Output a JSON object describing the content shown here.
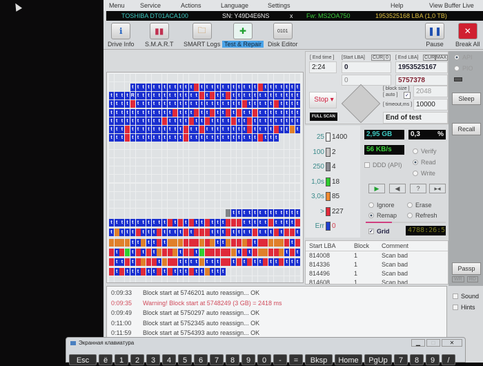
{
  "menu": [
    "Menu",
    "Service",
    "Actions",
    "Language",
    "Settings",
    "Help",
    "View Buffer Live"
  ],
  "drive": {
    "model": "TOSHIBA DT01ACA100",
    "sn": "SN: Y49D4E6NS",
    "x": "x",
    "fw": "Fw: MS2OA750",
    "lba": "1953525168 LBA (1,0 TB)"
  },
  "toolbar": {
    "drive_info": "Drive Info",
    "smart": "S.M.A.R.T",
    "smart_logs": "SMART Logs",
    "test_repair": "Test & Repair",
    "disk_editor": "Disk Editor",
    "pause": "Pause",
    "break_all": "Break All"
  },
  "controls": {
    "end_time_label": "[ End time ]",
    "end_time": "2:24",
    "start_lba_label": "[Start LBA]",
    "cur": "CUR",
    "zero": "0",
    "end_lba_label": "[ End LBA]",
    "max": "MAX",
    "start_lba": "0",
    "end_lba": "1953525167",
    "pos_start": "0",
    "pos_cur": "5757378",
    "block_size_label": "[ block size ]",
    "auto_label": "[ auto ]",
    "block_size": "2048",
    "timeout_label": "[ timeout,ms ]",
    "timeout": "10000",
    "stop": "Stop",
    "full_scan": "FULL SCAN",
    "end_action": "End of test"
  },
  "legend": [
    {
      "k": "25",
      "v": "1400",
      "color": "#f4f4f4"
    },
    {
      "k": "100",
      "v": "2",
      "color": "#c8c4c4"
    },
    {
      "k": "250",
      "v": "4",
      "color": "#8a8a90"
    },
    {
      "k": "1,0s",
      "v": "18",
      "color": "#2ecc2e"
    },
    {
      "k": "3,0s",
      "v": "85",
      "color": "#f08a30"
    },
    {
      "k": ">",
      "v": "227",
      "color": "#e02a3a"
    },
    {
      "k": "Err",
      "v": "0",
      "color": "#2040d0"
    }
  ],
  "stats": {
    "size": "2,95 GB",
    "percent": "0,3",
    "pct_sign": "%",
    "speed": "56 KB/s",
    "ddd": "DDD (API)",
    "verify": "Verify",
    "read": "Read",
    "write": "Write",
    "ignore": "Ignore",
    "erase": "Erase",
    "remap": "Remap",
    "refresh": "Refresh",
    "grid": "Grid",
    "timer": "4788:26:5",
    "progress": 0.3
  },
  "side": {
    "api": "API",
    "pio": "PIO",
    "sleep": "Sleep",
    "recall": "Recall",
    "passp": "Passp",
    "wr": "WR",
    "rd": "RD",
    "sound": "Sound",
    "hints": "Hints"
  },
  "table": {
    "headers": [
      "Start LBA",
      "Block",
      "Comment"
    ],
    "rows": [
      [
        "814008",
        "1",
        "Scan bad"
      ],
      [
        "814336",
        "1",
        "Scan bad"
      ],
      [
        "814496",
        "1",
        "Scan bad"
      ],
      [
        "814608",
        "1",
        "Scan bad"
      ]
    ]
  },
  "log": [
    {
      "time": "0:09:33",
      "msg": "Block start at 5746201 auto reassign... OK"
    },
    {
      "time": "0:09:35",
      "msg": "Warning! Block start at 5748249 (3 GB)  = 2418 ms",
      "warn": true
    },
    {
      "time": "0:09:49",
      "msg": "Block start at 5750297 auto reassign... OK"
    },
    {
      "time": "0:11:00",
      "msg": "Block start at 5752345 auto reassign... OK"
    },
    {
      "time": "0:11:59",
      "msg": "Block start at 5754393 auto reassign... OK"
    }
  ],
  "keyboard": {
    "title": "Экранная клавиатура",
    "keys": [
      "Esc",
      "ё",
      "1",
      "2",
      "3",
      "4",
      "5",
      "6",
      "7",
      "8",
      "9",
      "0",
      "-",
      "=",
      "Bksp",
      "Home",
      "PgUp",
      "7",
      "8",
      "9",
      "/"
    ]
  },
  "grid_top": [
    "....ttttttttttttrtttttttttttrttttttt",
    "ttttRttttttttttttrtrttrttttttttttttt",
    "ttttrttttttttttttttttttttrtttttrtttt",
    "ttttttttttttrtttrttrttrtrttrtttttttt",
    "ttttttttttrttttrttrttttrttrttttttttt",
    "tttrttttttttttrttrttttttttrttttrttot",
    "tttrttttttttttrtttttttttttttrttt...."
  ],
  "grid_bottom": [
    "......................kttttttttttttt",
    "tttttttttttrtrtrttrtttrrrtttttrttttr",
    "totttrtttrttttrtrrrtttrttttrtttrtrrt",
    "oooottottrtooorrrorottorrortrrooortr",
    "rtrgtrtrtorrotrrtgrrrrrotrtroorrotrt",
    "rttrtrorrtorrttttotttrrtrtrttrttrttt",
    "rtrtttrttrtrtttrttottt.............."
  ]
}
